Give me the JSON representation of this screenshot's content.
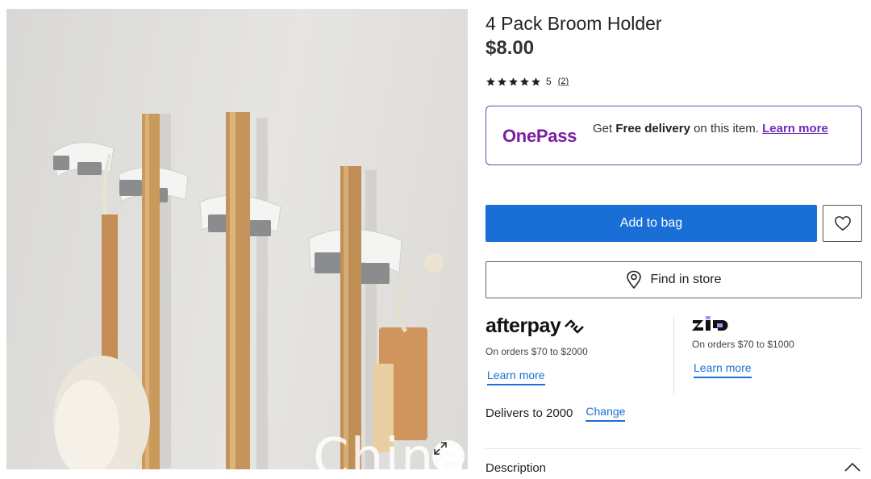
{
  "product": {
    "title": "4 Pack Broom Holder",
    "price": "$8.00",
    "rating_value": "5",
    "rating_count": "(2)",
    "stars": 5
  },
  "onepass": {
    "logo": "OnePass",
    "text_pre": "Get ",
    "text_bold": "Free delivery",
    "text_post": " on this item. ",
    "link": "Learn more",
    "brand_color": "#7a1fa2"
  },
  "actions": {
    "add_to_bag": "Add to bag",
    "find_in_store": "Find in store",
    "primary_color": "#1a6fd6"
  },
  "afterpay": {
    "logo": "afterpay",
    "note": "On orders $70 to $2000",
    "link": "Learn more"
  },
  "zip": {
    "logo": "zip",
    "note": "On orders $70 to $1000",
    "link": "Learn more"
  },
  "delivery": {
    "text": "Delivers to 2000",
    "change": "Change"
  },
  "description": {
    "label": "Description"
  },
  "image": {
    "watermark": "China"
  },
  "icons": [
    "star-icon",
    "heart-icon",
    "location-pin-icon",
    "expand-icon",
    "chevron-up-icon"
  ]
}
